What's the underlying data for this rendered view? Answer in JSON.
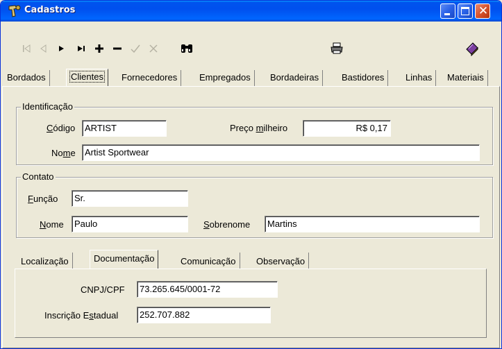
{
  "window": {
    "title": "Cadastros",
    "buttons": {
      "minimize": "minimize",
      "maximize": "maximize",
      "close": "close"
    }
  },
  "toolbar": {
    "tools": [
      {
        "name": "first-record-icon",
        "glyph": "|◁",
        "enabled": false
      },
      {
        "name": "prior-record-icon",
        "glyph": "◁",
        "enabled": false
      },
      {
        "name": "next-record-icon",
        "glyph": "►",
        "enabled": true
      },
      {
        "name": "last-record-icon",
        "glyph": "►|",
        "enabled": true
      },
      {
        "name": "insert-record-icon",
        "glyph": "+",
        "enabled": true
      },
      {
        "name": "delete-record-icon",
        "glyph": "−",
        "enabled": true
      },
      {
        "name": "post-record-icon",
        "glyph": "✓",
        "enabled": false
      },
      {
        "name": "cancel-record-icon",
        "glyph": "✕",
        "enabled": false
      },
      {
        "name": "binoculars-icon",
        "glyph": "binoculars",
        "enabled": true
      },
      {
        "name": "printer-icon",
        "glyph": "printer",
        "enabled": true
      },
      {
        "name": "book-icon",
        "glyph": "book",
        "enabled": true
      }
    ]
  },
  "tabs": [
    {
      "label": "Bordados",
      "active": false
    },
    {
      "label": "Clientes",
      "active": true
    },
    {
      "label": "Fornecedores",
      "active": false
    },
    {
      "label": "Empregados",
      "active": false
    },
    {
      "label": "Bordadeiras",
      "active": false
    },
    {
      "label": "Bastidores",
      "active": false
    },
    {
      "label": "Linhas",
      "active": false
    },
    {
      "label": "Materiais",
      "active": false
    }
  ],
  "identificacao": {
    "title": "Identificação",
    "codigo_label_u": "C",
    "codigo_label_rest": "ódigo",
    "codigo_value": "ARTIST",
    "preco_label_pre": "Preço ",
    "preco_label_u": "m",
    "preco_label_rest": "ilheiro",
    "preco_value": "R$ 0,17",
    "nome_label_pre": "No",
    "nome_label_u": "m",
    "nome_label_rest": "e",
    "nome_value": "Artist Sportwear"
  },
  "contato": {
    "title": "Contato",
    "funcao_label_u": "F",
    "funcao_label_rest": "unção",
    "funcao_value": "Sr.",
    "nome_label_u": "N",
    "nome_label_rest": "ome",
    "nome_value": "Paulo",
    "sobrenome_label_u": "S",
    "sobrenome_label_rest": "obrenome",
    "sobrenome_value": "Martins"
  },
  "subtabs": [
    {
      "label": "Localização",
      "active": false
    },
    {
      "label": "Documentação",
      "active": true
    },
    {
      "label": "Comunicação",
      "active": false
    },
    {
      "label": "Observação",
      "active": false
    }
  ],
  "documentacao": {
    "cnpj_label": "CNPJ/CPF",
    "cnpj_value": "73.265.645/0001-72",
    "ie_label_pre": "Inscrição E",
    "ie_label_u": "s",
    "ie_label_rest": "tadual",
    "ie_value": "252.707.882"
  },
  "colors": {
    "titlebar": "#0054e3",
    "window_bg": "#ece9d8",
    "close_button": "#d8542f"
  }
}
